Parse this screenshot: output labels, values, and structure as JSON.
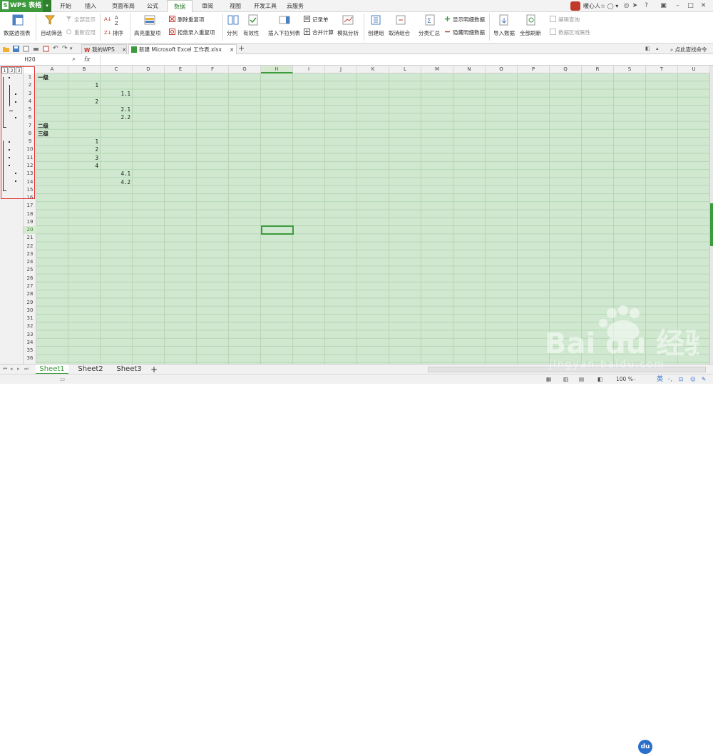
{
  "app": {
    "logo_text": "WPS 表格"
  },
  "menu": {
    "tabs": [
      "开始",
      "插入",
      "页面布局",
      "公式",
      "数据",
      "审阅",
      "视图",
      "开发工具",
      "云服务"
    ],
    "active": "数据"
  },
  "user": {
    "name": "暖心人☆ ◯ ▾"
  },
  "ribbon": {
    "pivot": "数据透视表",
    "autofilter": "自动筛选",
    "show_all": "全部显示",
    "reapply": "重新应用",
    "sort": "排序",
    "highlight_dup": "高亮重复项",
    "remove_dup": "删除重复项",
    "reject_dup": "拒绝录入重复项",
    "split": "分列",
    "validity": "有效性",
    "dropdown": "插入下拉列表",
    "record": "记录单",
    "merge_calc": "合并计算",
    "simulate": "模拟分析",
    "group": "创建组",
    "ungroup": "取消组合",
    "subtotal": "分类汇总",
    "show_detail": "显示明细数据",
    "hide_detail": "隐藏明细数据",
    "import": "导入数据",
    "refresh_all": "全部刷新",
    "edit_query": "编辑查询",
    "range_props": "数据区域属性"
  },
  "doc_tabs": [
    "我的WPS",
    "新建 Microsoft Excel 工作表.xlsx"
  ],
  "search_cmd": "点此查找命令",
  "formula": {
    "namebox": "H20",
    "fx": "fx",
    "content": ""
  },
  "outline": {
    "levels": [
      "1",
      "2",
      "3"
    ]
  },
  "columns": [
    "A",
    "B",
    "C",
    "D",
    "E",
    "F",
    "G",
    "H",
    "I",
    "J",
    "K",
    "L",
    "M",
    "N",
    "O",
    "P",
    "Q",
    "R",
    "S",
    "T",
    "U"
  ],
  "selected_column": "H",
  "selected_row": 20,
  "rows": [
    "1",
    "2",
    "3",
    "4",
    "5",
    "6",
    "7",
    "8",
    "9",
    "10",
    "11",
    "12",
    "13",
    "14",
    "15",
    "16",
    "17",
    "18",
    "19",
    "20",
    "21",
    "22",
    "23",
    "24",
    "25",
    "26",
    "27",
    "28",
    "29",
    "30",
    "31",
    "32",
    "33",
    "34",
    "35",
    "36"
  ],
  "cells": [
    {
      "ref": "A1",
      "text": "一级",
      "bold": true
    },
    {
      "ref": "B2",
      "text": "1",
      "align": "right"
    },
    {
      "ref": "C3",
      "text": "1.1",
      "align": "right"
    },
    {
      "ref": "B4",
      "text": "2",
      "align": "right"
    },
    {
      "ref": "C5",
      "text": "2.1",
      "align": "right"
    },
    {
      "ref": "C6",
      "text": "2.2",
      "align": "right"
    },
    {
      "ref": "A7",
      "text": "二级",
      "bold": true
    },
    {
      "ref": "A8",
      "text": "三级",
      "bold": true
    },
    {
      "ref": "B9",
      "text": "1",
      "align": "right"
    },
    {
      "ref": "B10",
      "text": "2",
      "align": "right"
    },
    {
      "ref": "B11",
      "text": "3",
      "align": "right"
    },
    {
      "ref": "B12",
      "text": "4",
      "align": "right"
    },
    {
      "ref": "C13",
      "text": "4.1",
      "align": "right"
    },
    {
      "ref": "C14",
      "text": "4.2",
      "align": "right"
    }
  ],
  "sheets": [
    "Sheet1",
    "Sheet2",
    "Sheet3"
  ],
  "active_sheet": "Sheet1",
  "status": {
    "zoom": "100 %",
    "ime": "英"
  },
  "watermark": {
    "brand": "Bai du 经验",
    "url": "jingyan.baidu.com"
  },
  "colors": {
    "accent": "#3d9a3d",
    "grid_bg": "#cfe8cf",
    "highlight": "#e03030"
  }
}
